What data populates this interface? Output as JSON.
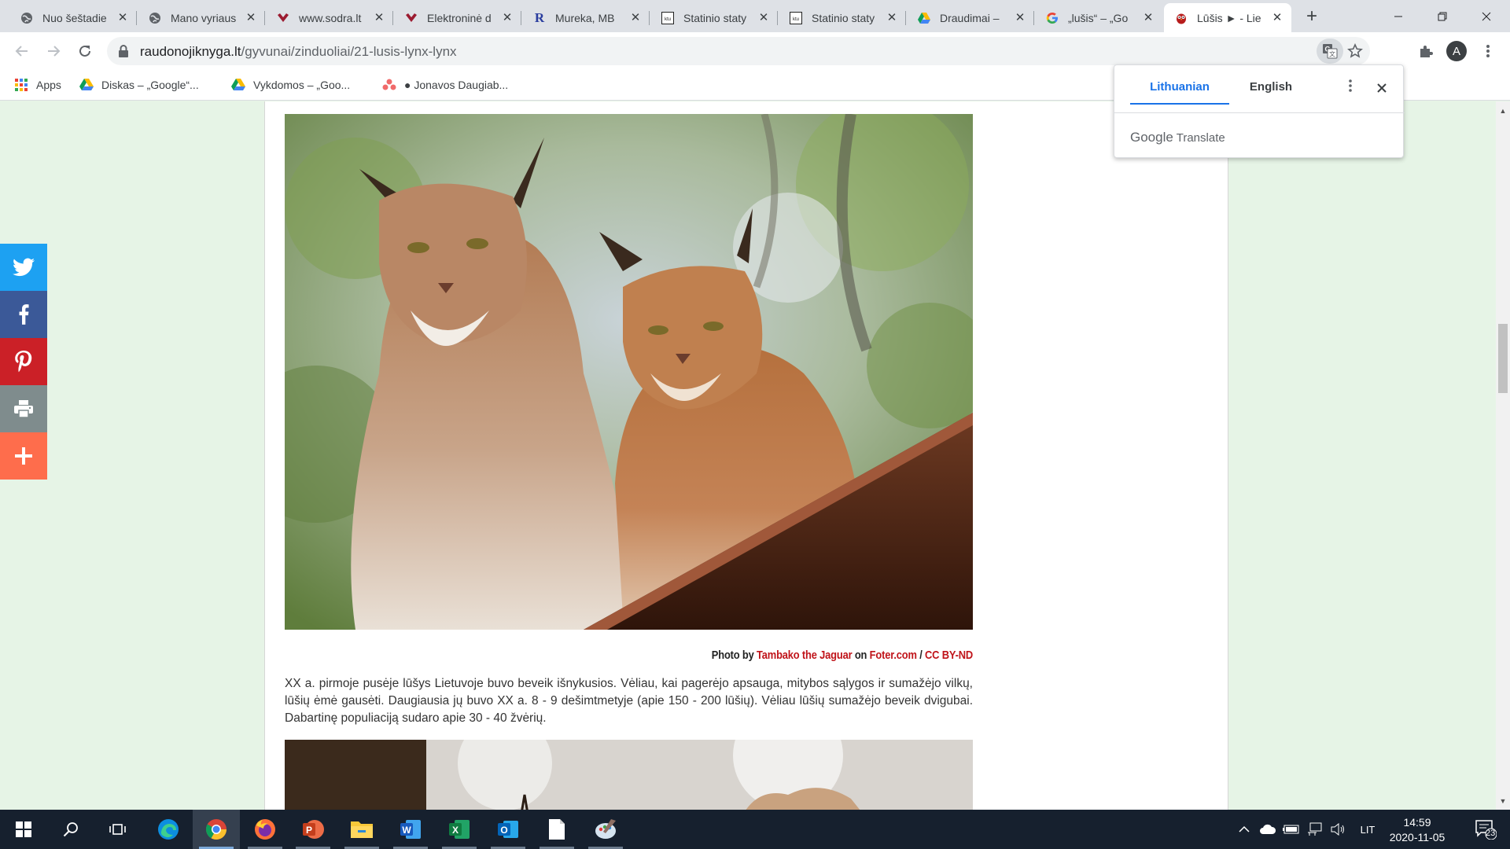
{
  "tabs": [
    {
      "label": "Nuo šeštadie",
      "icon": "globe-icon"
    },
    {
      "label": "Mano vyriaus",
      "icon": "globe-icon"
    },
    {
      "label": "www.sodra.lt",
      "icon": "sodra-icon"
    },
    {
      "label": "Elektroninė d",
      "icon": "sodra-icon"
    },
    {
      "label": "Mureka, MB",
      "icon": "r-logo-icon"
    },
    {
      "label": "Statinio staty",
      "icon": "ktu-icon"
    },
    {
      "label": "Statinio staty",
      "icon": "ktu-icon"
    },
    {
      "label": "Draudimai –",
      "icon": "drive-icon"
    },
    {
      "label": "„lušis“ – „Go",
      "icon": "google-icon"
    },
    {
      "label": "Lūšis ► - Lie",
      "icon": "owl-icon",
      "active": true
    }
  ],
  "address_bar": {
    "domain": "raudonojiknyga.lt",
    "path": "/gyvunai/zinduoliai/21-lusis-lynx-lynx"
  },
  "profile_initial": "A",
  "bookmarks": [
    {
      "label": "Apps",
      "icon": "apps-grid-icon"
    },
    {
      "label": "Diskas – „Google“...",
      "icon": "drive-icon"
    },
    {
      "label": "Vykdomos – „Goo...",
      "icon": "drive-icon"
    },
    {
      "label": "● Jonavos Daugiab...",
      "icon": "asana-icon"
    }
  ],
  "translate_popup": {
    "source_lang": "Lithuanian",
    "target_lang": "English",
    "brand_google": "Google",
    "brand_translate": "Translate"
  },
  "share_bar": [
    {
      "name": "twitter",
      "color": "#1da1f2"
    },
    {
      "name": "facebook",
      "color": "#3b5998"
    },
    {
      "name": "pinterest",
      "color": "#cb2027"
    },
    {
      "name": "print",
      "color": "#7f8c8d"
    },
    {
      "name": "more",
      "color": "#fe6d4c"
    }
  ],
  "article": {
    "credit": {
      "prefix": "Photo by",
      "author": "Tambako the Jaguar",
      "on": "on",
      "site": "Foter.com",
      "slash": "/",
      "license": "CC BY-ND"
    },
    "paragraph": "XX a. pirmoje pusėje lūšys Lietuvoje buvo beveik išnykusios. Vėliau, kai pagerėjo apsauga, mitybos sąlygos ir sumažėjo vilkų, lūšių ėmė gausėti. Daugiausia jų buvo XX a. 8 - 9 dešimtmetyje (apie 150 - 200 lūšių). Vėliau lūšių sumažėjo beveik dvigubai. Dabartinę populiaciją sudaro apie 30 -  40 žvėrių."
  },
  "taskbar": {
    "apps": [
      "start-icon",
      "search-icon",
      "task-view-icon",
      "edge-icon",
      "chrome-icon",
      "firefox-icon",
      "powerpoint-icon",
      "file-explorer-icon",
      "word-icon",
      "excel-icon",
      "outlook-icon",
      "notepad-icon",
      "paint-icon"
    ],
    "language": "LIT",
    "time": "14:59",
    "date": "2020-11-05",
    "notifications": "23"
  }
}
